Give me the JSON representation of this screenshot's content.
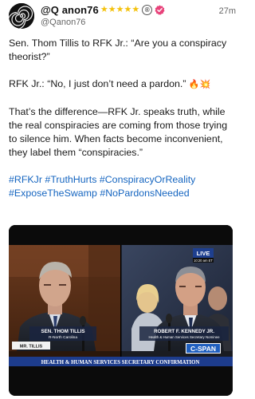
{
  "header": {
    "display_name": "@Q anon76",
    "handle": "@Qanon76",
    "timestamp": "27m",
    "star_count": 5,
    "star_color": "#f4c20d",
    "registered_mark": "®",
    "avatar_icon": "spiral-logo-icon",
    "verified_icon": "verified-badge-icon",
    "verified_color": "#e8427a"
  },
  "post": {
    "line1": "Sen. Thom Tillis to RFK Jr.: “Are you a conspiracy theorist?”",
    "line2": "RFK Jr.: “No, I just don’t need a pardon.”",
    "line2_emojis": "🔥💥",
    "line3": "That’s the difference—RFK Jr. speaks truth, while the real conspiracies are coming from those trying to silence him. When facts become inconvenient, they label them “conspiracies.”",
    "hashtags": "#RFKJr #TruthHurts #ConspiracyOrReality #ExposeTheSwamp #NoPardonsNeeded",
    "hashtag_color": "#1565c0"
  },
  "video": {
    "left_nameplate": {
      "name": "SEN. THOM TILLIS",
      "subtitle": "R-North Carolina"
    },
    "desk_sign": "MR. TILLIS",
    "right_nameplate": {
      "name": "ROBERT F. KENNEDY JR.",
      "subtitle": "Health & Human Services Secretary Nominee"
    },
    "live_badge": "LIVE",
    "live_time": "10:20 am ET",
    "network_logo": "C-SPAN",
    "lower_third": "HEALTH & HUMAN SERVICES SECRETARY CONFIRMATION"
  }
}
